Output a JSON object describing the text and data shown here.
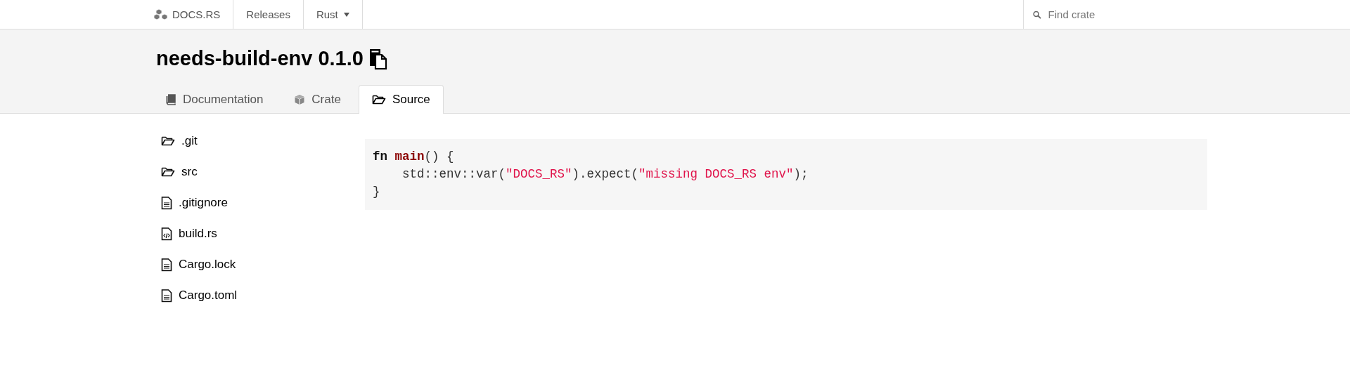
{
  "navbar": {
    "logo": "DOCS.RS",
    "links": [
      {
        "label": "Releases",
        "kind": "link"
      },
      {
        "label": "Rust",
        "kind": "menu"
      }
    ],
    "search": {
      "placeholder": "Find crate"
    }
  },
  "crate": {
    "title": "needs-build-env 0.1.0"
  },
  "tabs": [
    {
      "label": "Documentation",
      "selected": false
    },
    {
      "label": "Crate",
      "selected": false
    },
    {
      "label": "Source",
      "selected": true
    }
  ],
  "files": [
    {
      "name": ".git",
      "kind": "folder"
    },
    {
      "name": "src",
      "kind": "folder"
    },
    {
      "name": ".gitignore",
      "kind": "text"
    },
    {
      "name": "build.rs",
      "kind": "code"
    },
    {
      "name": "Cargo.lock",
      "kind": "text"
    },
    {
      "name": "Cargo.toml",
      "kind": "text"
    }
  ],
  "code": [
    [
      {
        "text": "fn",
        "kind": "keyword"
      },
      {
        "text": " main",
        "kind": "function"
      },
      {
        "text": "() {",
        "kind": "plain"
      }
    ],
    [
      {
        "text": "    std::env::var(",
        "kind": "plain"
      },
      {
        "text": "\"DOCS_RS\"",
        "kind": "string"
      },
      {
        "text": ").expect(",
        "kind": "plain"
      },
      {
        "text": "\"missing DOCS_RS env\"",
        "kind": "string"
      },
      {
        "text": ");",
        "kind": "plain"
      }
    ],
    [
      {
        "text": "}",
        "kind": "plain"
      }
    ]
  ]
}
